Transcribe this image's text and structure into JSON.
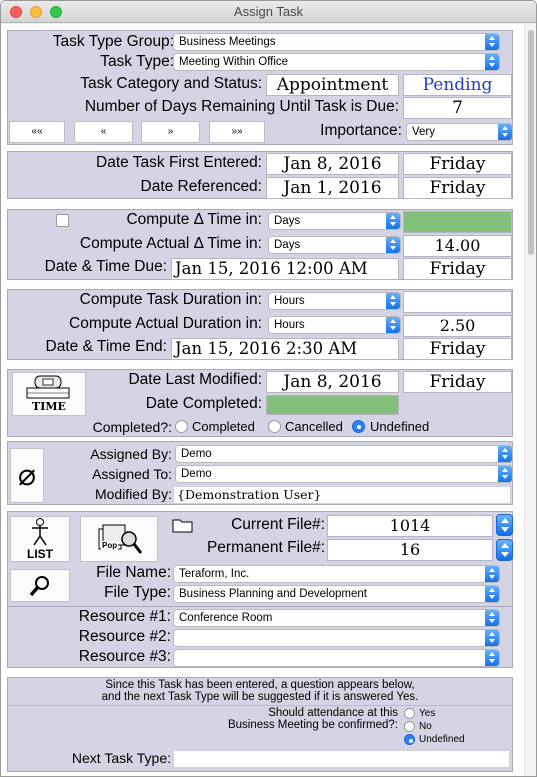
{
  "window": {
    "title": "Assign Task"
  },
  "colors": {
    "panel": "#d4d4e4",
    "accent": "#2d7ff5",
    "status_blue": "#1f3fbf",
    "green_field": "#84c07c"
  },
  "task": {
    "type_group_label": "Task Type Group:",
    "type_group_value": "Business Meetings",
    "type_label": "Task Type:",
    "type_value": "Meeting Within Office",
    "category_status_label": "Task Category and Status:",
    "category_value": "Appointment",
    "status_value": "Pending",
    "days_remaining_label": "Number of Days Remaining Until Task is Due:",
    "days_remaining_value": "7",
    "nav_buttons": [
      "««",
      "«",
      "»",
      "»»"
    ],
    "importance_label": "Importance:",
    "importance_value": "Very"
  },
  "dates": {
    "first_entered_label": "Date Task First Entered:",
    "first_entered_value": "Jan 8, 2016",
    "first_entered_day": "Friday",
    "referenced_label": "Date Referenced:",
    "referenced_value": "Jan 1, 2016",
    "referenced_day": "Friday"
  },
  "due": {
    "compute_label": "Compute Δ Time in:",
    "compute_value": "Days",
    "compute_actual_label": "Compute Actual Δ Time in:",
    "compute_actual_value": "Days",
    "compute_actual_result": "14.00",
    "datetime_label": "Date & Time Due:",
    "datetime_value": "Jan 15, 2016  12:00 AM",
    "datetime_day": "Friday"
  },
  "duration": {
    "compute_label": "Compute Task Duration in:",
    "compute_value": "Hours",
    "compute_actual_label": "Compute Actual Duration in:",
    "compute_actual_value": "Hours",
    "compute_actual_result": "2.50",
    "end_label": "Date & Time End:",
    "end_value": "Jan 15, 2016  2:30 AM",
    "end_day": "Friday"
  },
  "modified": {
    "time_icon_label": "TIME",
    "last_modified_label": "Date Last Modified:",
    "last_modified_value": "Jan 8, 2016",
    "last_modified_day": "Friday",
    "completed_date_label": "Date Completed:",
    "completed_label": "Completed?:",
    "completed_options": [
      "Completed",
      "Cancelled",
      "Undefined"
    ],
    "completed_selected": "Undefined"
  },
  "assign": {
    "null_icon": "⌀",
    "assigned_by_label": "Assigned By:",
    "assigned_by_value": "Demo",
    "assigned_to_label": "Assigned To:",
    "assigned_to_value": "Demo",
    "modified_by_label": "Modified By:",
    "modified_by_value": "{Demonstration User}"
  },
  "file": {
    "list_icon_label": "LIST",
    "pop_icon_label": "Pop",
    "current_label": "Current File#:",
    "current_value": "1014",
    "permanent_label": "Permanent File#:",
    "permanent_value": "16",
    "name_label": "File Name:",
    "name_value": "Teraform, Inc.",
    "type_label": "File Type:",
    "type_value": "Business Planning and Development"
  },
  "resources": {
    "r1_label": "Resource #1:",
    "r1_value": "Conference Room",
    "r2_label": "Resource #2:",
    "r2_value": "",
    "r3_label": "Resource #3:",
    "r3_value": ""
  },
  "followup": {
    "info_line1": "Since this Task has been entered, a question appears below,",
    "info_line2": "and the next Task Type will be suggested if it is answered Yes.",
    "question_line1": "Should attendance at this",
    "question_line2": "Business Meeting be confirmed?:",
    "options": [
      "Yes",
      "No",
      "Undefined"
    ],
    "selected": "Undefined",
    "next_type_label": "Next Task Type:",
    "next_type_value": ""
  }
}
